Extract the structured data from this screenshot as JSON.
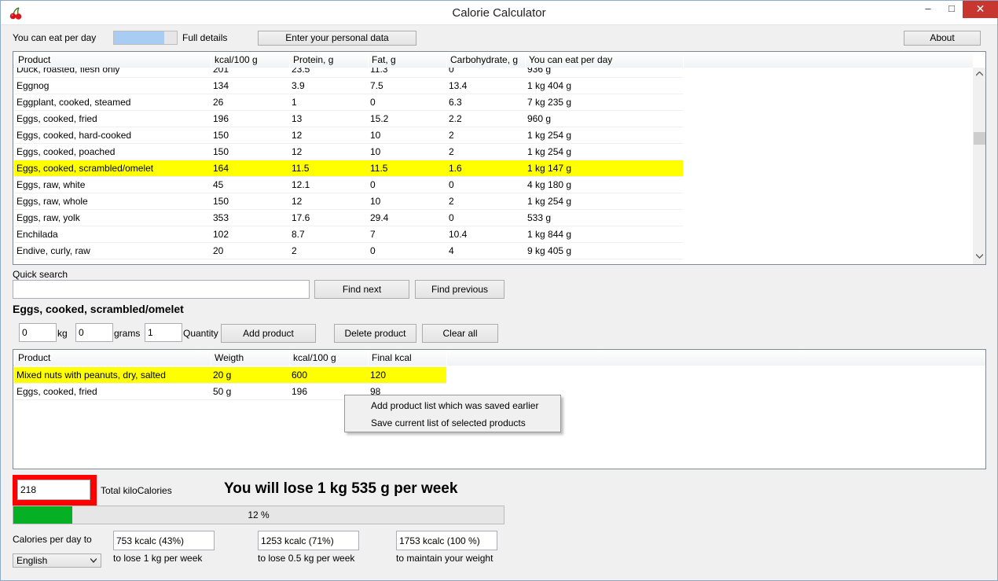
{
  "window": {
    "title": "Calorie Calculator",
    "min": "–",
    "max": "□",
    "close": "✕"
  },
  "top": {
    "you_can_eat": "You can eat per day",
    "full_details": "Full details",
    "enter_personal": "Enter your personal data",
    "about": "About"
  },
  "products_table": {
    "columns": [
      "Product",
      "kcal/100 g",
      "Protein, g",
      "Fat, g",
      "Carbohydrate, g",
      "You can eat per day"
    ],
    "rows": [
      [
        "Duck, roasted, flesh only",
        "201",
        "23.5",
        "11.3",
        "0",
        "936 g"
      ],
      [
        "Eggnog",
        "134",
        "3.9",
        "7.5",
        "13.4",
        "1 kg 404 g"
      ],
      [
        "Eggplant, cooked, steamed",
        "26",
        "1",
        "0",
        "6.3",
        "7 kg 235 g"
      ],
      [
        "Eggs, cooked, fried",
        "196",
        "13",
        "15.2",
        "2.2",
        "960 g"
      ],
      [
        "Eggs, cooked, hard-cooked",
        "150",
        "12",
        "10",
        "2",
        "1 kg 254 g"
      ],
      [
        "Eggs, cooked, poached",
        "150",
        "12",
        "10",
        "2",
        "1 kg 254 g"
      ],
      [
        "Eggs, cooked, scrambled/omelet",
        "164",
        "11.5",
        "11.5",
        "1.6",
        "1 kg 147 g"
      ],
      [
        "Eggs, raw, white",
        "45",
        "12.1",
        "0",
        "0",
        "4 kg 180 g"
      ],
      [
        "Eggs, raw, whole",
        "150",
        "12",
        "10",
        "2",
        "1 kg 254 g"
      ],
      [
        "Eggs, raw, yolk",
        "353",
        "17.6",
        "29.4",
        "0",
        "533 g"
      ],
      [
        "Enchilada",
        "102",
        "8.7",
        "7",
        "10.4",
        "1 kg 844 g"
      ],
      [
        "Endive, curly, raw",
        "20",
        "2",
        "0",
        "4",
        "9 kg 405 g"
      ]
    ],
    "selected_index": 6
  },
  "search": {
    "label": "Quick search",
    "value": "",
    "find_next": "Find next",
    "find_previous": "Find previous"
  },
  "selected_product": "Eggs, cooked, scrambled/omelet",
  "add": {
    "kg_value": "0",
    "kg_label": "kg",
    "grams_value": "0",
    "grams_label": "grams",
    "qty_value": "1",
    "qty_label": "Quantity",
    "add_button": "Add product",
    "delete_button": "Delete product",
    "clear_button": "Clear all"
  },
  "selected_table": {
    "columns": [
      "Product",
      "Weigth",
      "kcal/100 g",
      "Final kcal"
    ],
    "rows": [
      [
        "Mixed nuts with peanuts, dry, salted",
        "20 g",
        "600",
        "120"
      ],
      [
        "Eggs, cooked, fried",
        "50 g",
        "196",
        "98"
      ]
    ],
    "highlight_index": 0
  },
  "context_menu": {
    "items": [
      "Add product list which was saved earlier",
      "Save current list of selected products"
    ]
  },
  "totals": {
    "total_value": "218",
    "total_label": "Total kiloCalories",
    "message": "You will lose 1 kg 535 g per week",
    "progress_text": "12 %",
    "progress_fraction": 0.12
  },
  "calories": {
    "label": "Calories per day to",
    "lose1": "753 kcalc (43%)",
    "lose1_label": "to lose 1 kg per week",
    "lose05": "1253 kcalc (71%)",
    "lose05_label": "to lose 0.5 kg per week",
    "maintain": "1753 kcalc (100 %)",
    "maintain_label": "to maintain your weight"
  },
  "language": {
    "selected": "English"
  },
  "colors": {
    "highlight": "#ffff00",
    "progress": "#06b025",
    "total_border": "#ff0000",
    "close": "#c7372f"
  }
}
